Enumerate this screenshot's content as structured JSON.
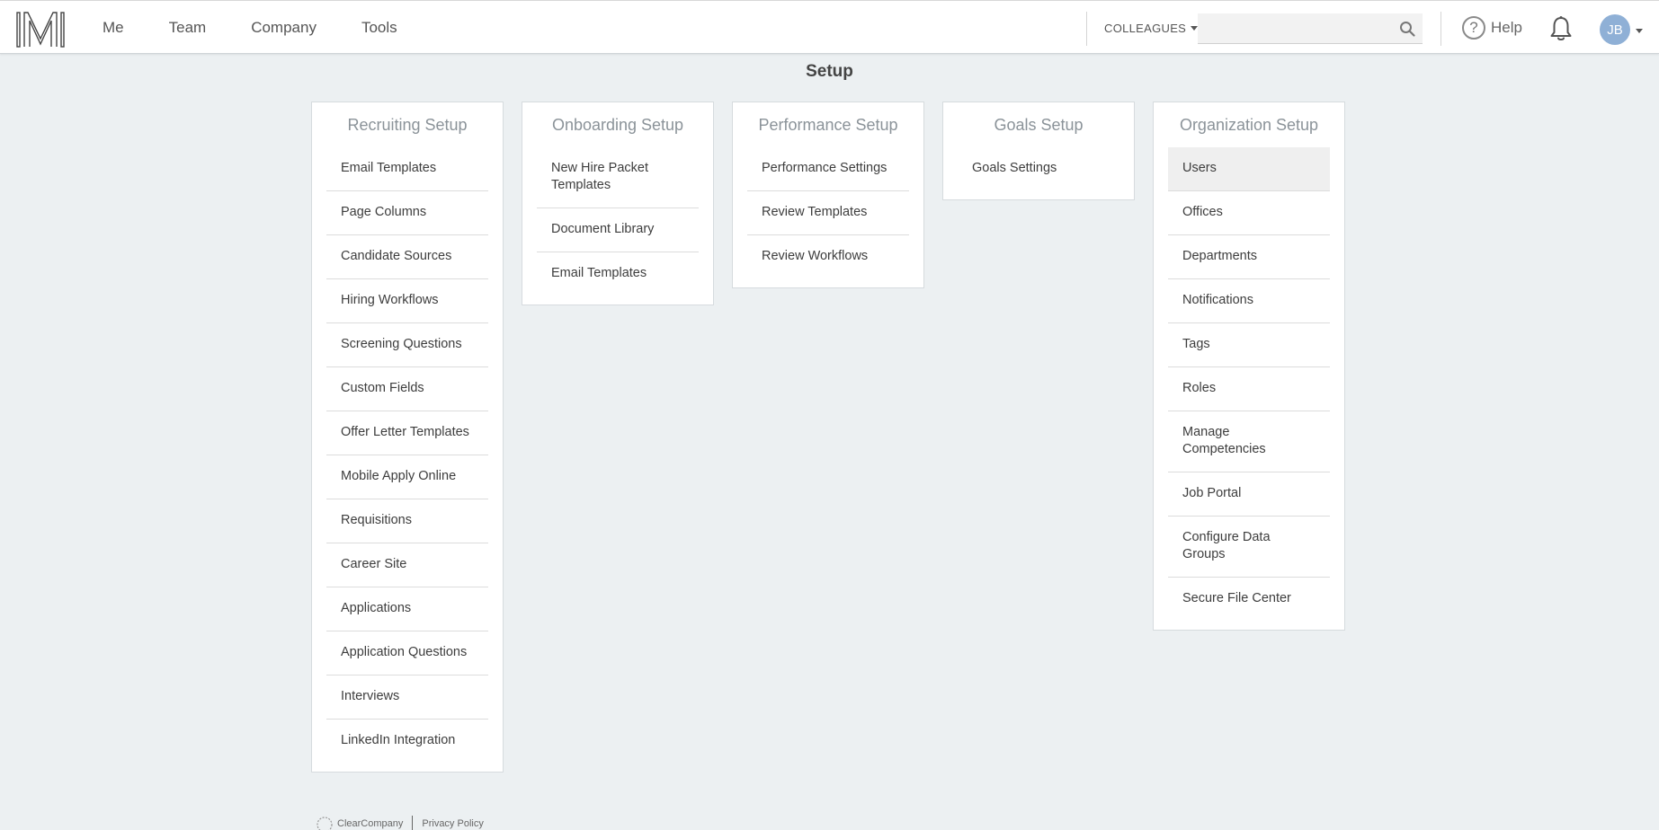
{
  "header": {
    "nav": [
      "Me",
      "Team",
      "Company",
      "Tools"
    ],
    "colleagues_label": "COLLEAGUES",
    "search_placeholder": "",
    "help_label": "Help",
    "avatar_initials": "JB"
  },
  "page": {
    "title": "Setup"
  },
  "cards": [
    {
      "title": "Recruiting Setup",
      "items": [
        "Email Templates",
        "Page Columns",
        "Candidate Sources",
        "Hiring Workflows",
        "Screening Questions",
        "Custom Fields",
        "Offer Letter Templates",
        "Mobile Apply Online",
        "Requisitions",
        "Career Site",
        "Applications",
        "Application Questions",
        "Interviews",
        "LinkedIn Integration"
      ]
    },
    {
      "title": "Onboarding Setup",
      "items": [
        "New Hire Packet Templates",
        "Document Library",
        "Email Templates"
      ]
    },
    {
      "title": "Performance Setup",
      "items": [
        "Performance Settings",
        "Review Templates",
        "Review Workflows"
      ]
    },
    {
      "title": "Goals Setup",
      "items": [
        "Goals Settings"
      ]
    },
    {
      "title": "Organization Setup",
      "items": [
        "Users",
        "Offices",
        "Departments",
        "Notifications",
        "Tags",
        "Roles",
        "Manage Competencies",
        "Job Portal",
        "Configure Data Groups",
        "Secure File Center"
      ]
    }
  ],
  "footer": {
    "brand": "ClearCompany",
    "privacy": "Privacy Policy"
  }
}
